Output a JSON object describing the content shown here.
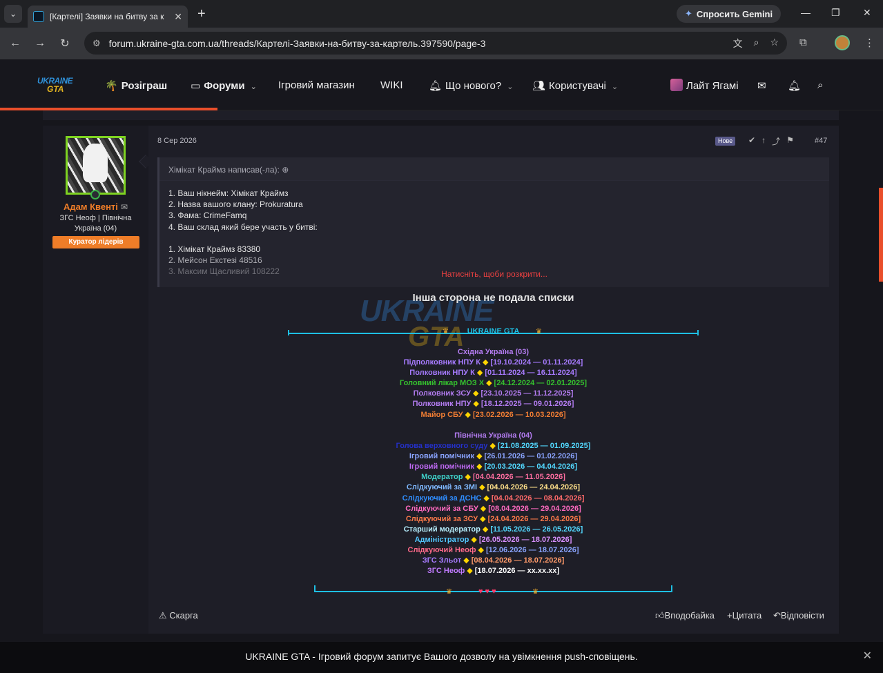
{
  "browser": {
    "tab_title": "[Картелі] Заявки на битву за к",
    "url": "forum.ukraine-gta.com.ua/threads/Картелі-Заявки-на-битву-за-картель.397590/page-3",
    "gemini_label": "Спросить Gemini"
  },
  "header": {
    "logo_top": "UKRAINE",
    "logo_bottom": "GTA",
    "nav": {
      "giveaway": "Розіграш",
      "forums": "Форуми",
      "shop": "Ігровий магазин",
      "wiki": "WIKI",
      "whats_new": "Що нового?",
      "users": "Користувачі",
      "username": "Лайт Ягамі"
    }
  },
  "post": {
    "author": "Адам Квенті",
    "author_title": "ЗГС Неоф | Північна Україна (04)",
    "author_banner": "Куратор лідерів",
    "date": "8 Сер 2026",
    "new_badge": "Нове",
    "number": "#47",
    "quote_header": "Хімікат Краймз написав(-ла):",
    "quote_lines": [
      "1. Ваш нікнейм: Хімікат Краймз",
      "2. Назва вашого клану: Prokuratura",
      "3. Фама: CrimeFamq",
      "4. Ваш склад який бере участь у битві:",
      "",
      "1. Хімікат Краймз 83380",
      "2. Мейсон Екстезі 48516",
      "3. Максим Щасливий 108222"
    ],
    "quote_expand": "Натисніть, щоби розкрити...",
    "main_text": "Інша сторона не подала списки",
    "signature": {
      "watermark_top": "UKRAINE",
      "watermark_bottom": "GTA",
      "title": "UKRAINE GTA",
      "section1": "Східна Україна (03)",
      "section1_rows": [
        {
          "role": "Підполковник НПУ К",
          "dates": "[19.10.2024 — 01.11.2024]",
          "c1": "#a77bff",
          "c2": "#a77bff"
        },
        {
          "role": "Полковник НПУ К",
          "dates": "[01.11.2024 — 16.11.2024]",
          "c1": "#a77bff",
          "c2": "#a77bff"
        },
        {
          "role": "Головний лікар МОЗ Х",
          "dates": "[24.12.2024 — 02.01.2025]",
          "c1": "#35c22e",
          "c2": "#35c22e"
        },
        {
          "role": "Полковник ЗСУ",
          "dates": "[23.10.2025 — 11.12.2025]",
          "c1": "#b37cf0",
          "c2": "#b37cf0"
        },
        {
          "role": "Полковник НПУ",
          "dates": "[18.12.2025 — 09.01.2026]",
          "c1": "#b37cf0",
          "c2": "#b37cf0"
        },
        {
          "role": "Майор СБУ",
          "dates": "[23.02.2026 — 10.03.2026]",
          "c1": "#f07d33",
          "c2": "#f07d33"
        }
      ],
      "section2": "Північна Україна (04)",
      "section2_rows": [
        {
          "role": "Голова верховного суду",
          "dates": "[21.08.2025 — 01.09.2025]",
          "c1": "#2430c8",
          "c2": "#52d8ff"
        },
        {
          "role": "Ігровий помічник",
          "dates": "[26.01.2026 — 01.02.2026]",
          "c1": "#8aa4ff",
          "c2": "#8aa4ff"
        },
        {
          "role": "Ігровий помічник",
          "dates": "[20.03.2026 — 04.04.2026]",
          "c1": "#c06af5",
          "c2": "#52d8ff"
        },
        {
          "role": "Модератор",
          "dates": "[04.04.2026 — 11.05.2026]",
          "c1": "#3ed0c8",
          "c2": "#ff6ea0"
        },
        {
          "role": "Слідкуючий за ЗМІ",
          "dates": "[04.04.2026 — 24.04.2026]",
          "c1": "#7fb9ff",
          "c2": "#ffe08a"
        },
        {
          "role": "Слідкуючий за ДСНС",
          "dates": "[04.04.2026 — 08.04.2026]",
          "c1": "#2f8dff",
          "c2": "#ff6a6a"
        },
        {
          "role": "Слідкуючий за СБУ",
          "dates": "[08.04.2026 — 29.04.2026]",
          "c1": "#ff6ac0",
          "c2": "#ff6ac0"
        },
        {
          "role": "Слідкуючий за ЗСУ",
          "dates": "[24.04.2026 — 29.04.2026]",
          "c1": "#ff7a4a",
          "c2": "#ff7a4a"
        },
        {
          "role": "Старший модератор",
          "dates": "[11.05.2026 — 26.05.2026]",
          "c1": "#b8f0ff",
          "c2": "#52d8ff"
        },
        {
          "role": "Адміністратор",
          "dates": "[26.05.2026 — 18.07.2026]",
          "c1": "#52c8ff",
          "c2": "#d890ff"
        },
        {
          "role": "Слідкуючий Неоф",
          "dates": "[12.06.2026 — 18.07.2026]",
          "c1": "#ff6a8a",
          "c2": "#8aa4ff"
        },
        {
          "role": "ЗГС Зльот",
          "dates": "[08.04.2026 — 18.07.2026]",
          "c1": "#a77bff",
          "c2": "#ff9a6a"
        },
        {
          "role": "ЗГС Неоф",
          "dates": "[18.07.2026 — xx.xx.xx]",
          "c1": "#c07bff",
          "c2": "#ffffff"
        }
      ]
    },
    "actions": {
      "report": "Скарга",
      "like": "Вподобайка",
      "quote": "+Цитата",
      "reply": "Відповісти"
    }
  },
  "notification": {
    "text": "UKRAINE GTA - Ігровий форум запитує Вашого дозволу на увімкнення push-сповіщень."
  },
  "colors": {
    "accent": "#e94f2b",
    "author": "#ef7d28",
    "divider": "#1ec0e4"
  }
}
